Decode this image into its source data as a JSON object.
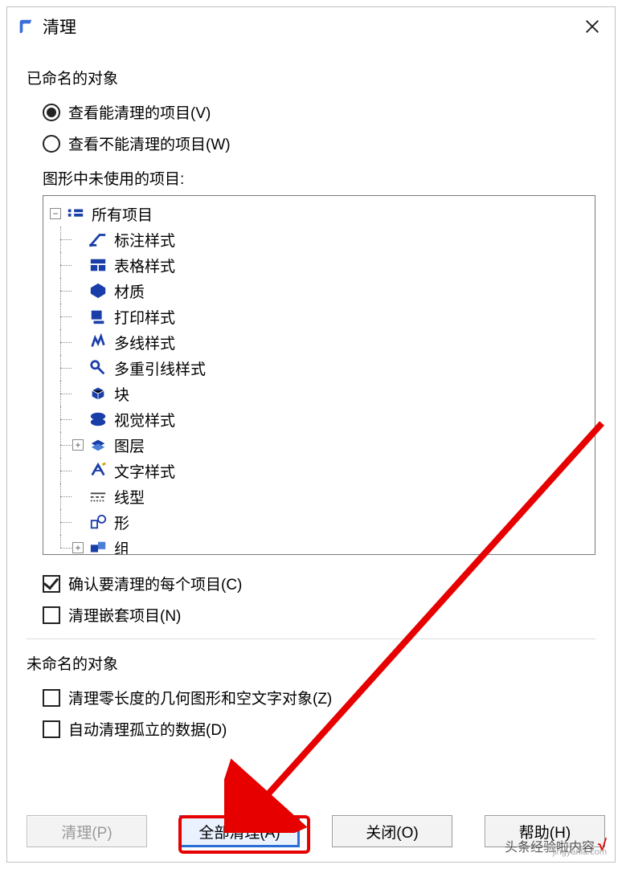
{
  "title": "清理",
  "section_named_objects": "已命名的对象",
  "radio_purgeable": "查看能清理的项目(V)",
  "radio_not_purgeable": "查看不能清理的项目(W)",
  "tree_label": "图形中未使用的项目:",
  "tree": {
    "root": "所有项目",
    "items": [
      {
        "label": "标注样式"
      },
      {
        "label": "表格样式"
      },
      {
        "label": "材质"
      },
      {
        "label": "打印样式"
      },
      {
        "label": "多线样式"
      },
      {
        "label": "多重引线样式"
      },
      {
        "label": "块"
      },
      {
        "label": "视觉样式"
      },
      {
        "label": "图层",
        "expandable": true
      },
      {
        "label": "文字样式"
      },
      {
        "label": "线型"
      },
      {
        "label": "形"
      },
      {
        "label": "组",
        "expandable": true
      }
    ]
  },
  "check_confirm_each": "确认要清理的每个项目(C)",
  "check_purge_nested": "清理嵌套项目(N)",
  "section_unnamed_objects": "未命名的对象",
  "check_zero_length": "清理零长度的几何图形和空文字对象(Z)",
  "check_orphan_data": "自动清理孤立的数据(D)",
  "buttons": {
    "purge": "清理(P)",
    "purge_all": "全部清理(A)",
    "close": "关闭(O)",
    "help": "帮助(H)"
  },
  "watermark": {
    "text": "头条经验啦内容",
    "domain": "jingyanla.com"
  }
}
